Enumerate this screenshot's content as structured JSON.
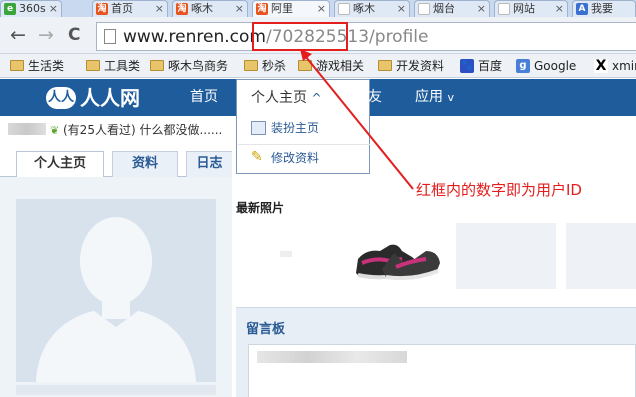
{
  "browser": {
    "tabs": [
      {
        "label": "360s",
        "icon_color": "#3aa53a",
        "icon_char": "e"
      },
      {
        "label": "首页",
        "icon_color": "#e8541e",
        "icon_char": "淘"
      },
      {
        "label": "啄木",
        "icon_color": "#e8541e",
        "icon_char": "淘"
      },
      {
        "label": "阿里",
        "icon_color": "#e8541e",
        "icon_char": "淘"
      },
      {
        "label": "啄木",
        "icon_color": "#ffffff",
        "icon_char": ""
      },
      {
        "label": "烟台",
        "icon_color": "#ffffff",
        "icon_char": ""
      },
      {
        "label": "网站",
        "icon_color": "#ffffff",
        "icon_char": ""
      },
      {
        "label": "我要",
        "icon_color": "#3b6fd0",
        "icon_char": "A"
      }
    ],
    "tab_close": "×",
    "back": "←",
    "forward": "→",
    "reload": "C",
    "url_host": "www.renren.com",
    "url_slash": "/",
    "url_id": "702825513",
    "url_rest": "/profile",
    "bookmarks": [
      {
        "label": "生活类",
        "type": "folder"
      },
      {
        "label": "工具类",
        "type": "folder"
      },
      {
        "label": "啄木鸟商务",
        "type": "folder"
      },
      {
        "label": "秒杀",
        "type": "folder"
      },
      {
        "label": "游戏相关",
        "type": "folder"
      },
      {
        "label": "开发资料",
        "type": "folder"
      },
      {
        "label": "百度",
        "type": "paw-icon"
      },
      {
        "label": "Google",
        "type": "google-icon"
      },
      {
        "label": "xmind",
        "type": "x-icon"
      }
    ]
  },
  "site": {
    "logo_text": "人人网",
    "nav": {
      "home": "首页",
      "profile": "个人主页",
      "profile_caret": "^",
      "friends": "好友",
      "apps": "应用",
      "apps_caret": "v"
    },
    "dropdown": {
      "item1": "装扮主页",
      "item2": "修改资料"
    },
    "status_text": "(有25人看过) 什么都没做......",
    "profile_tabs": [
      "个人主页",
      "资料",
      "日志"
    ],
    "photos_title": "最新照片",
    "guestbook_title": "留言板"
  },
  "annotation": {
    "text": "红框内的数字即为用户ID",
    "color": "#e41d1d"
  }
}
